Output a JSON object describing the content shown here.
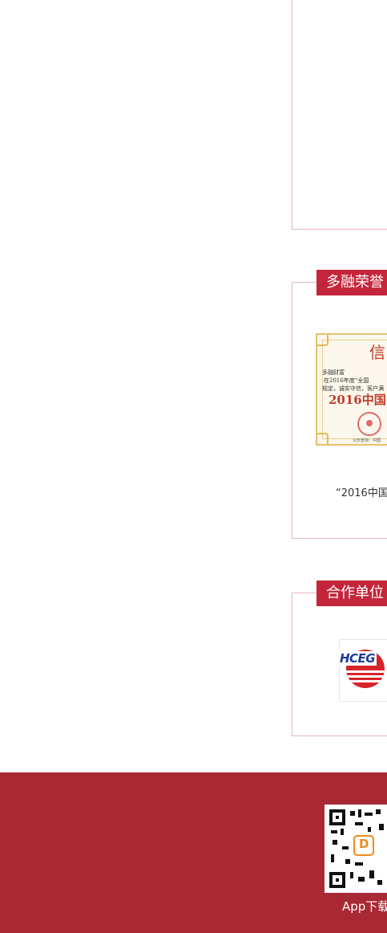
{
  "sections": {
    "honor": {
      "title": "多融荣誉",
      "certificate": {
        "heading": "信",
        "line1": "多融财富",
        "line2": "在2016年度“全国",
        "line3": "规定，诚实守信，客户满",
        "big_text": "2016中国",
        "footer": "公示查询：中国"
      },
      "caption": "“2016中国"
    },
    "partners": {
      "title": "合作单位",
      "logo_text": "HCEG"
    }
  },
  "footer": {
    "qr_center_label": "D",
    "app_download_label": "App下载"
  },
  "colors": {
    "accent": "#c5253a",
    "footer_bg": "#a82834",
    "box_border": "#e3b7bc"
  }
}
